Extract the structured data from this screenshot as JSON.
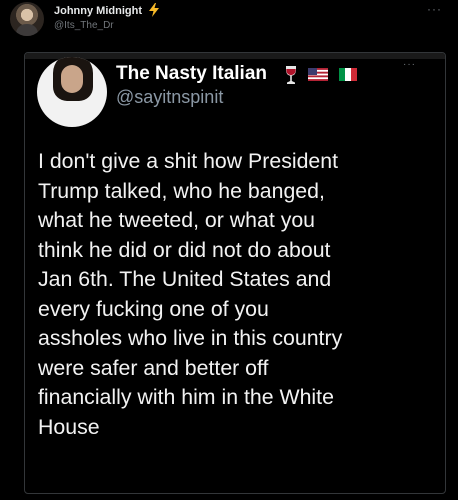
{
  "post": {
    "author_name": "Johnny Midnight",
    "author_handle": "@Its_The_Dr",
    "author_icon": "lightning-bolt-icon",
    "more_icon": "···"
  },
  "quoted": {
    "name": "The Nasty Italian",
    "handle": "@sayitnspinit",
    "name_icons": [
      "wine-glass-icon",
      "us-flag-icon",
      "italy-flag-icon"
    ],
    "more_icon": "···",
    "text_lines": [
      "I don't give a shit how President",
      "Trump talked, who he banged,",
      "what he tweeted, or what you",
      "think he did or did not do about",
      "Jan 6th. The United States and",
      "every fucking one of you",
      "assholes who live in this country",
      "were safer and better off",
      "financially with him in the White",
      "House"
    ]
  },
  "colors": {
    "background": "#000000",
    "bolt": "#f7b928",
    "muted": "#71767b",
    "text": "#f2f2f2"
  }
}
